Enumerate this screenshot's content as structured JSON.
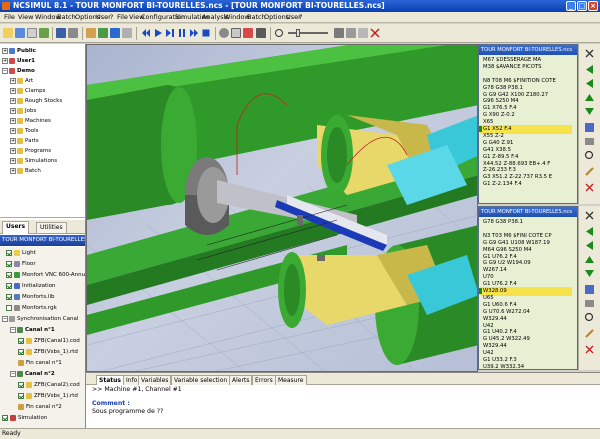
{
  "window": {
    "title": "NCSIMUL 8.1 - TOUR MONFORT BI-TOURELLES.ncs - [TOUR MONFORT BI-TOURELLES.ncs]"
  },
  "menu": [
    "File",
    "View",
    "Window",
    "Batch",
    "Options",
    "User",
    "?",
    "File",
    "View",
    "Configuration",
    "Simulation",
    "Analysis",
    "Window",
    "Batch",
    "Options",
    "User",
    "?"
  ],
  "tree": {
    "items": [
      {
        "label": "Public",
        "bold": true
      },
      {
        "label": "User1",
        "bold": true
      },
      {
        "label": "Demo",
        "bold": true
      },
      {
        "label": "Art"
      },
      {
        "label": "Clamps"
      },
      {
        "label": "Rough Stocks"
      },
      {
        "label": "Jobs"
      },
      {
        "label": "Machines"
      },
      {
        "label": "Tools"
      },
      {
        "label": "Parts"
      },
      {
        "label": "Programs"
      },
      {
        "label": "Simulations"
      },
      {
        "label": "Batch"
      }
    ]
  },
  "left_tabs": [
    "Users",
    "Utilities"
  ],
  "project": {
    "title": "TOUR MONFORT BI-TOURELLES",
    "items": [
      {
        "label": "Light",
        "checked": true
      },
      {
        "label": "Floor",
        "checked": true
      },
      {
        "label": "Monfort VNC 600-Annu",
        "checked": true
      },
      {
        "label": "Initialization",
        "checked": true
      },
      {
        "label": "Monforts.lib",
        "checked": true
      },
      {
        "label": "Monforts.rgk",
        "checked": false
      },
      {
        "label": "Synchronisation Canal",
        "checked": false
      },
      {
        "label": "Canal n°1",
        "bold": true
      },
      {
        "label": "ZFB(Canal1).cod",
        "checked": true
      },
      {
        "label": "ZFB(Vsbs_1).rtd",
        "checked": true
      },
      {
        "label": "Fin canal n°1",
        "checked": false
      },
      {
        "label": "Canal n°2",
        "bold": true
      },
      {
        "label": "ZFB(Canal2).cod",
        "checked": true
      },
      {
        "label": "ZFB(Vsbs_1).rtd",
        "checked": true
      },
      {
        "label": "Fin canal n°2",
        "checked": false
      },
      {
        "label": "Simulation",
        "checked": true
      }
    ]
  },
  "nc1": {
    "title": "TOUR MONFORT BI-TOURELLES.ncs",
    "lines": [
      "M67 $DESSERAGE MA",
      "M38 $AVANCE PICOTS",
      "",
      "N8 T08 M6 $FINITION COTE",
      "G78 G38 P38.1",
      "G G9 G42 X100 Z180.27",
      "G96 S250 M4",
      "G1 X76.5 F.4",
      "G X90 Z-0.2",
      "X65",
      "G1 X52 F.4",
      "X55 Z-2",
      "G G40 Z.91",
      "G41 X38.5",
      "G1 Z-89.5 F.4",
      "X44.52 Z-88.693 EB+.4 F",
      "Z-26.233 F.3",
      "G3 X51.2 Z-22.737 R3.5 E",
      "G1 Z-2.134 F.4"
    ],
    "highlight": 10
  },
  "nc2": {
    "title": "TOUR MONFORT BI-TOURELLES.ncs",
    "lines": [
      "G78 G38 P38.1",
      "",
      "N3 T03 M6 $FINI COTE CP",
      "G G9 G41 U108 W187.19",
      "M64 G96 S250 M4",
      "G1 U76.2 F.4",
      "G G9 U2 W194.09",
      "W267.14",
      "U70",
      "G1 U76.2 F.4",
      "W328.09",
      "U65",
      "G1 U60.6 F.4",
      "G U70.6 W272.04",
      "W329.44",
      "U42",
      "G1 U40.2 F.4",
      "G U45.2 W322.49",
      "W329.44",
      "U42",
      "G1 U33.2 F.3",
      "U39.2 W332.34"
    ],
    "highlight": 10
  },
  "bottom": {
    "tabs": [
      "Status",
      "Info",
      "Variables",
      "Variable selection",
      "Alerts",
      "Errors",
      "Measure"
    ],
    "lines": [
      ">> Machine #1, Channel #1",
      "",
      "Comment :",
      "Sous programme de ??"
    ]
  },
  "status": "Ready",
  "colors": {
    "machine_green": "#2f9a2a",
    "part_yellow": "#e8d86a",
    "highlight": "#f6e24a",
    "title_blue": "#0a3fb0"
  }
}
